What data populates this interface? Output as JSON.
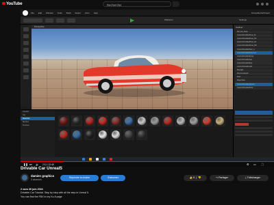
{
  "youtube": {
    "logo_text": "YouTube",
    "search_placeholder": "Rechercher",
    "icons": [
      "create-icon",
      "notifications-icon",
      "account-avatar"
    ]
  },
  "editor": {
    "menu_items": [
      "File",
      "Edit",
      "Window",
      "Tools",
      "Build",
      "Select",
      "Actor",
      "Help"
    ],
    "project_name": "DriveableCarProject",
    "toolbar_platform": "Platforms",
    "toolbar_settings": "Settings",
    "viewport_label": "Perspective",
    "outliner_title": "Outliner",
    "outliner_rows": [
      {
        "label": "SM_Car_Body",
        "selected": false
      },
      {
        "label": "CustomDrivableWheel_FL",
        "selected": false
      },
      {
        "label": "CustomDrivableWheel_FR",
        "selected": false
      },
      {
        "label": "CustomDrivableWheel_RL",
        "selected": false
      },
      {
        "label": "CustomDrivableWheel_RR",
        "selected": false
      },
      {
        "label": "CustomDrivablePawn_C",
        "selected": false
      },
      {
        "label": "CustomDrivableMovement",
        "selected": true
      },
      {
        "label": "CustomDrivableSpring",
        "selected": false
      },
      {
        "label": "CustomDrivableSeat",
        "selected": false
      },
      {
        "label": "CustomDrivableBody",
        "selected": false
      },
      {
        "label": "CustomDrivableLight",
        "selected": false
      },
      {
        "label": "SkyLight",
        "selected": false
      },
      {
        "label": "DirectionalLight",
        "selected": false
      },
      {
        "label": "Floor",
        "selected": false
      },
      {
        "label": "PlayerStart",
        "selected": false
      },
      {
        "label": "CustomDrivableCamera",
        "selected": true
      },
      {
        "label": "CustomDrivableWorld",
        "selected": false
      }
    ],
    "content_tree": [
      {
        "label": "Content",
        "selected": false
      },
      {
        "label": "Car",
        "selected": false
      },
      {
        "label": "Materials",
        "selected": true
      },
      {
        "label": "Meshes",
        "selected": false
      },
      {
        "label": "Textures",
        "selected": false
      }
    ],
    "thumb_colors": [
      "#7a1a14",
      "#2a2a2a",
      "#b2221c",
      "#c32a22",
      "#8a2f2a",
      "#3a6ea8",
      "#c9c9c9",
      "#9a9a9a",
      "#b82a22",
      "#b8b8b8",
      "#a0a0a0",
      "#d04030",
      "#c8b07a",
      "#b62a1f",
      "#2f6ea5",
      "#222222",
      "#e8e8e8",
      "#dddddd",
      "#444444",
      "#333333"
    ]
  },
  "player": {
    "current_time": "2:11",
    "total_time": "12:46",
    "progress_fraction": 0.17
  },
  "video": {
    "title": "Drivable Car Unreal5",
    "channel_name": "damien graphics",
    "subscribers": "3 abonnés",
    "join_label": "Rejoindre la chaîne",
    "subscribe_label": "S'abonner",
    "likes": "9",
    "share_label": "Partager",
    "download_label": "Télécharger"
  },
  "description": {
    "meta": "2 vues 30 juin 2024",
    "line1": "Drivable Car Tutorial. Step by step with all the step in Unreal 5.",
    "line2": "You can find the FBX in my Ko-fi page"
  }
}
